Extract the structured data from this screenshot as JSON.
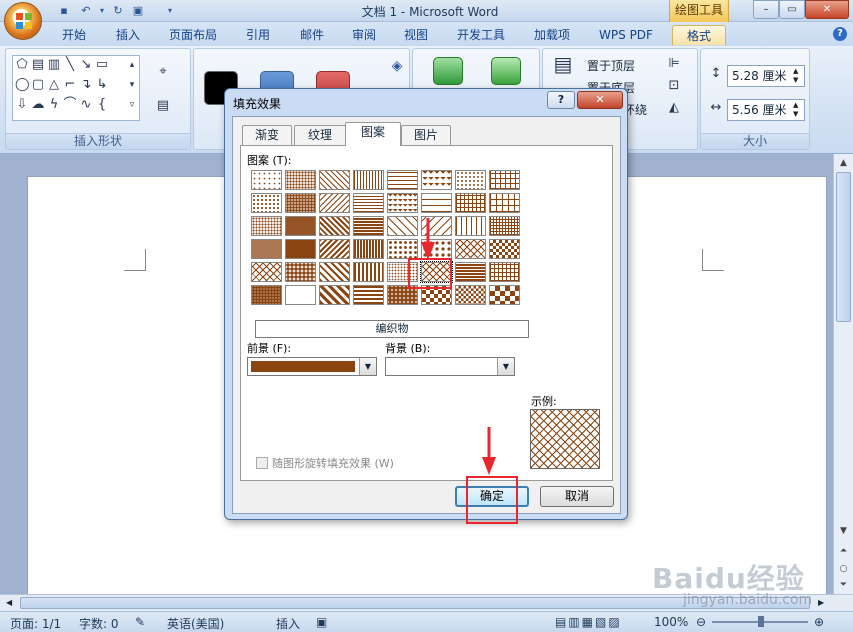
{
  "window": {
    "title": "文档 1 - Microsoft Word",
    "context_title": "绘图工具",
    "minimize": "–",
    "maximize": "▭",
    "close": "✕"
  },
  "tabs": [
    {
      "label": "开始",
      "active": false
    },
    {
      "label": "插入",
      "active": false
    },
    {
      "label": "页面布局",
      "active": false
    },
    {
      "label": "引用",
      "active": false
    },
    {
      "label": "邮件",
      "active": false
    },
    {
      "label": "审阅",
      "active": false
    },
    {
      "label": "视图",
      "active": false
    },
    {
      "label": "开发工具",
      "active": false
    },
    {
      "label": "加载项",
      "active": false
    },
    {
      "label": "WPS PDF",
      "active": false
    },
    {
      "label": "格式",
      "active": true
    }
  ],
  "ribbon": {
    "insert_shapes_label": "插入形状",
    "size_label": "大小",
    "bring_front": "置于顶层",
    "send_back": "置于底层",
    "wrap": "环绕",
    "height_value": "5.28 厘米",
    "width_value": "5.56 厘米"
  },
  "dialog": {
    "title": "填充效果",
    "help": "?",
    "close": "✕",
    "tabs": [
      {
        "label": "渐变",
        "active": false
      },
      {
        "label": "纹理",
        "active": false
      },
      {
        "label": "图案",
        "active": true
      },
      {
        "label": "图片",
        "active": false
      }
    ],
    "pattern_label": "图案 (T):",
    "pattern_name": "编织物",
    "foreground_label": "前景 (F):",
    "background_label": "背景 (B):",
    "foreground_color": "#8b4513",
    "background_color": "#ffffff",
    "sample_label": "示例:",
    "rotate_checkbox_label": "随图形旋转填充效果 (W)",
    "ok_button": "确定",
    "cancel_button": "取消",
    "selected_pattern_row": 4,
    "selected_pattern_col": 5
  },
  "status": {
    "page": "页面: 1/1",
    "words": "字数: 0",
    "language": "英语(美国)",
    "insert_mode": "插入",
    "zoom": "100%"
  },
  "watermark": {
    "text": "Baidu经验",
    "url": "jingyan.baidu.com"
  },
  "colors": {
    "accent": "#8b4513",
    "highlight": "#e8272f",
    "ribbon": "#d4e2f4"
  }
}
